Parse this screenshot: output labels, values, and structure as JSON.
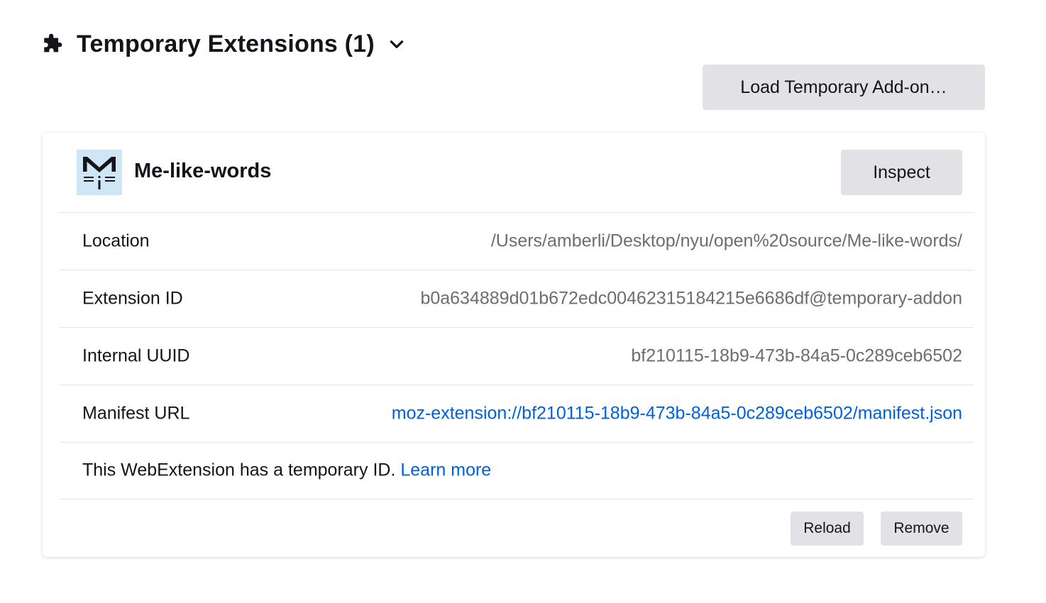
{
  "section": {
    "title": "Temporary Extensions (1)",
    "icon": "puzzle-icon",
    "toggle_icon": "chevron-down-icon"
  },
  "load_button": {
    "label": "Load Temporary Add-on…"
  },
  "extension": {
    "name": "Me-like-words",
    "icon": "extension-logo",
    "inspect_label": "Inspect",
    "rows": [
      {
        "label": "Location",
        "value": "/Users/amberli/Desktop/nyu/open%20source/Me-like-words/"
      },
      {
        "label": "Extension ID",
        "value": "b0a634889d01b672edc00462315184215e6686df@temporary-addon"
      },
      {
        "label": "Internal UUID",
        "value": "bf210115-18b9-473b-84a5-0c289ceb6502"
      },
      {
        "label": "Manifest URL",
        "value": "moz-extension://bf210115-18b9-473b-84a5-0c289ceb6502/manifest.json"
      }
    ],
    "message": "This WebExtension has a temporary ID.",
    "learn_more": "Learn more",
    "reload_label": "Reload",
    "remove_label": "Remove"
  },
  "colors": {
    "text": "#15141a",
    "secondary_text": "#6c6c72",
    "link": "#0061e0",
    "button_bg": "#e2e2e6",
    "icon_bg": "#cfe6f7"
  }
}
